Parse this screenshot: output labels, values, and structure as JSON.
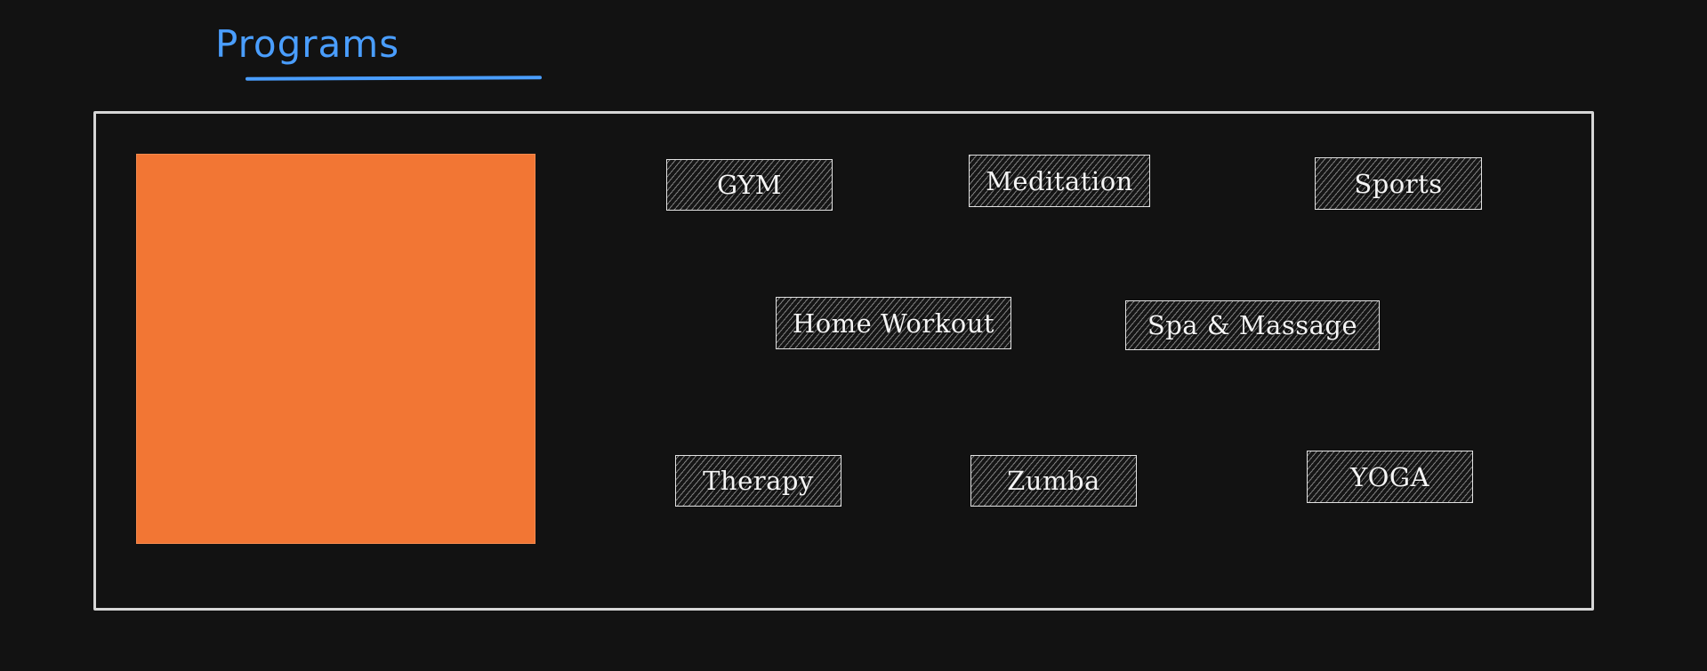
{
  "header": {
    "title": "Programs",
    "accent_color": "#4a9eff"
  },
  "panel": {
    "image_color": "#f27634",
    "programs": [
      {
        "label": "GYM"
      },
      {
        "label": "Meditation"
      },
      {
        "label": "Sports"
      },
      {
        "label": "Home Workout"
      },
      {
        "label": "Spa & Massage"
      },
      {
        "label": "Therapy"
      },
      {
        "label": "Zumba"
      },
      {
        "label": "YOGA"
      }
    ]
  }
}
